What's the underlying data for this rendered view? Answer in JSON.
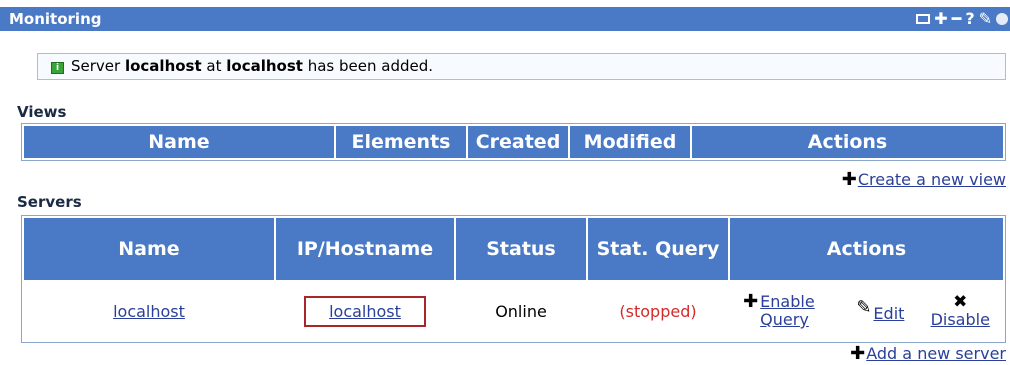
{
  "window": {
    "title": "Monitoring"
  },
  "title_icons": [
    "window-icon",
    "plus-icon",
    "minus-icon",
    "help-icon",
    "pencil-icon",
    "circle-icon"
  ],
  "message": {
    "prefix": "Server ",
    "server_name": "localhost",
    "middle": " at ",
    "host": "localhost",
    "suffix": " has been added."
  },
  "views": {
    "heading": "Views",
    "columns": [
      "Name",
      "Elements",
      "Created",
      "Modified",
      "Actions"
    ],
    "create_link": "Create a new view"
  },
  "servers": {
    "heading": "Servers",
    "columns": [
      "Name",
      "IP/Hostname",
      "Status",
      "Stat. Query",
      "Actions"
    ],
    "rows": [
      {
        "name": "localhost",
        "host": "localhost",
        "status": "Online",
        "stat_query": "(stopped)",
        "actions": {
          "enable": "Enable Query",
          "edit": "Edit",
          "disable": "Disable"
        }
      }
    ],
    "add_link": "Add a new server"
  },
  "colors": {
    "header_bg": "#4a7ac6",
    "stopped": "#d42a2a",
    "highlight": "#a8262a"
  }
}
